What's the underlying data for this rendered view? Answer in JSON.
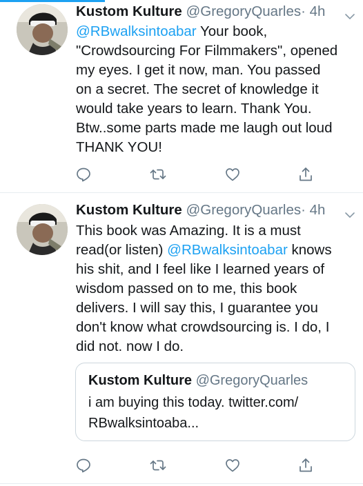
{
  "tweets": [
    {
      "author": {
        "display_name": "Kustom Kulture",
        "handle": "@GregoryQuarles",
        "dot": "·",
        "time": "4h"
      },
      "segments": [
        {
          "text": "@RBwalksintoabar",
          "type": "mention"
        },
        {
          "text": " Your book,\n\"Crowdsourcing For Filmmakers\", opened\nmy eyes. I get it now, man. You passed\non a secret. The secret of knowledge it\nwould take years to learn. Thank You.\nBtw..some parts made me laugh out loud\nTHANK YOU!",
          "type": "text"
        }
      ]
    },
    {
      "author": {
        "display_name": "Kustom Kulture",
        "handle": "@GregoryQuarles",
        "dot": "·",
        "time": "4h"
      },
      "segments": [
        {
          "text": "This book was Amazing. It is a must\nread(or listen) ",
          "type": "text"
        },
        {
          "text": "@RBwalksintoabar",
          "type": "mention"
        },
        {
          "text": " knows\nhis shit, and I feel like I learned years of\nwisdom passed on to me, this book\ndelivers. I will say this, I guarantee you\ndon't know what  crowdsourcing is. I do, I\ndid not. now I do.",
          "type": "text"
        }
      ],
      "quote": {
        "display_name": "Kustom Kulture",
        "handle": "@GregoryQuarles",
        "text": "i am buying this today. twitter.com/\nRBwalksintoaba..."
      }
    }
  ],
  "icons": {
    "reply": "reply-icon",
    "retweet": "retweet-icon",
    "like": "like-icon",
    "share": "share-icon",
    "menu": "chevron-down-icon"
  },
  "colors": {
    "accent": "#1da1f2",
    "text": "#14171a",
    "muted": "#657786",
    "divider": "#e6ecf0"
  }
}
